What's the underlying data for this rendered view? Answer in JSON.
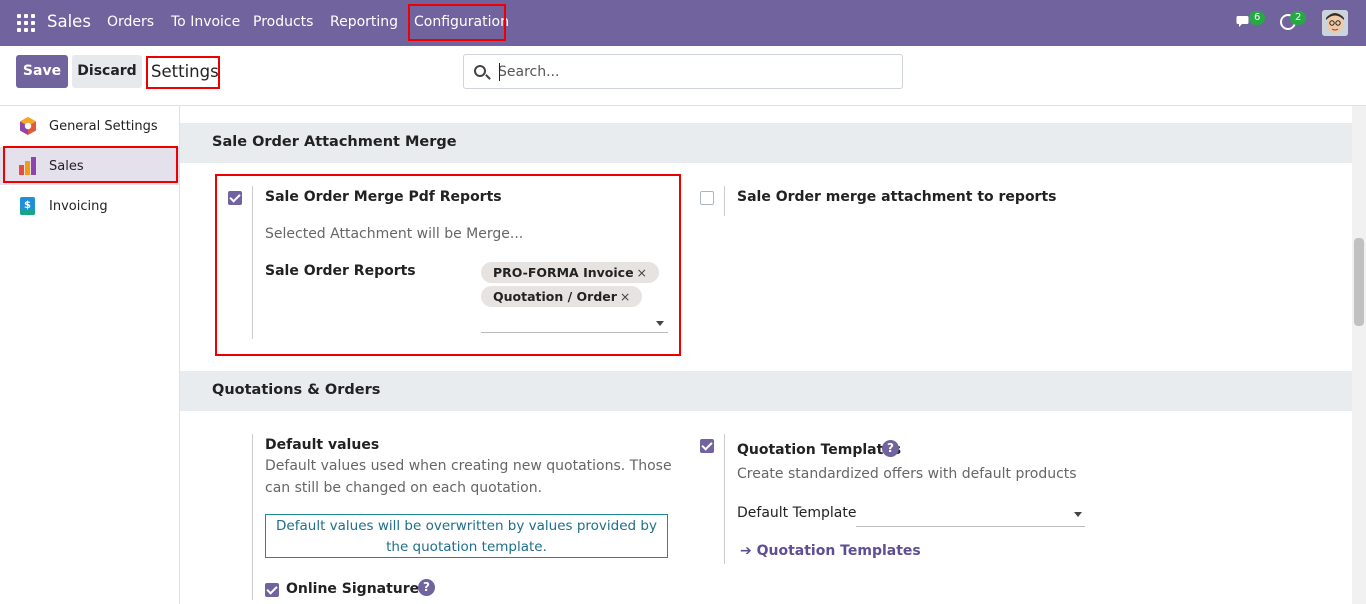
{
  "nav": {
    "brand": "Sales",
    "items": [
      "Orders",
      "To Invoice",
      "Products",
      "Reporting",
      "Configuration"
    ],
    "chat_count": "6",
    "activity_count": "2"
  },
  "control_panel": {
    "save_label": "Save",
    "discard_label": "Discard",
    "title": "Settings",
    "search_placeholder": "Search..."
  },
  "sidebar": {
    "items": [
      {
        "label": "General Settings",
        "icon": "general-settings-icon"
      },
      {
        "label": "Sales",
        "icon": "sales-icon"
      },
      {
        "label": "Invoicing",
        "icon": "invoicing-icon"
      }
    ]
  },
  "sections": {
    "attachment_merge": {
      "title": "Sale Order Attachment Merge",
      "merge_pdf": {
        "label": "Sale Order Merge Pdf Reports",
        "checked": true,
        "description": "Selected Attachment will be Merge...",
        "reports_label": "Sale Order Reports",
        "tags": [
          "PRO-FORMA Invoice",
          "Quotation / Order"
        ]
      },
      "merge_attachment": {
        "label": "Sale Order merge attachment to reports",
        "checked": false
      }
    },
    "quotations": {
      "title": "Quotations & Orders",
      "default_values": {
        "label": "Default values",
        "description": "Default values used when creating new quotations. Those can still be changed on each quotation.",
        "info": "Default values will be overwritten by values provided by the quotation template."
      },
      "online_signature": {
        "label": "Online Signature",
        "checked": true
      },
      "quotation_templates": {
        "label": "Quotation Templates",
        "checked": true,
        "description": "Create standardized offers with default products",
        "default_template_label": "Default Template",
        "link": "Quotation Templates"
      }
    }
  },
  "colors": {
    "brand": "#71639e",
    "highlight": "#ee0000",
    "info": "#1f8a9b"
  }
}
